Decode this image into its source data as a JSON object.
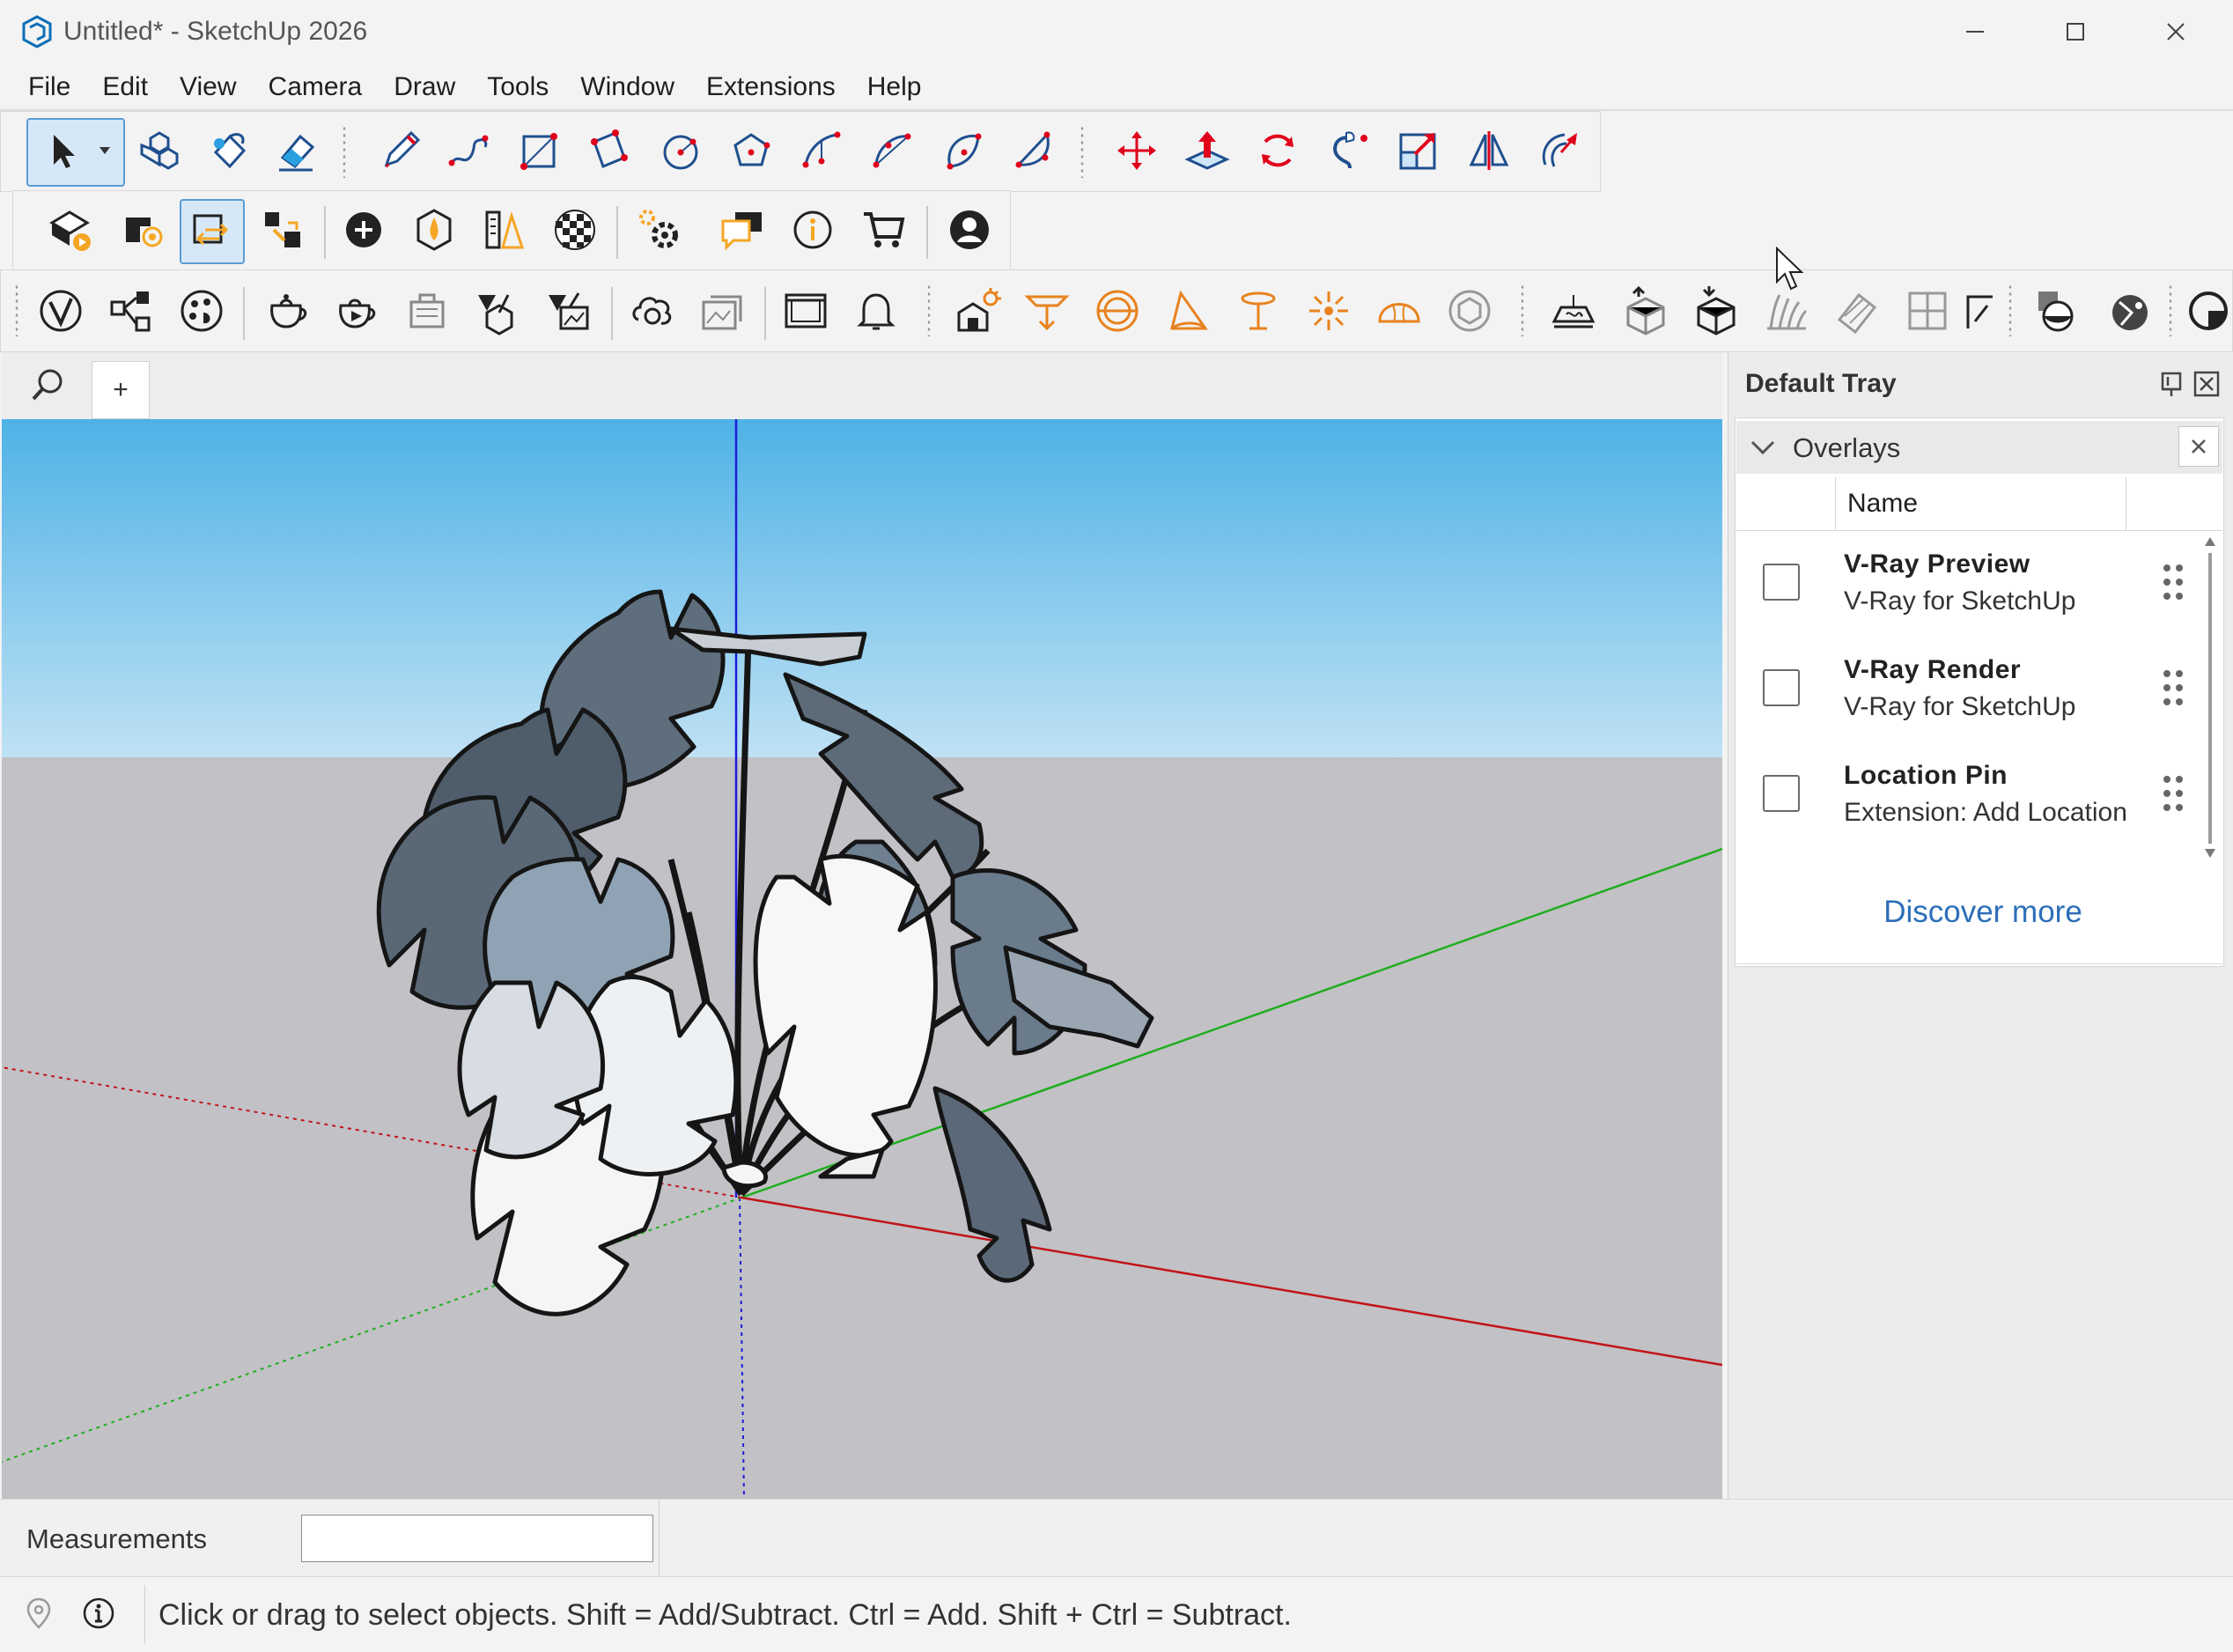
{
  "window": {
    "title": "Untitled* - SketchUp 2026",
    "controls": [
      "minimize",
      "maximize",
      "close"
    ]
  },
  "menu": [
    "File",
    "Edit",
    "View",
    "Camera",
    "Draw",
    "Tools",
    "Window",
    "Extensions",
    "Help"
  ],
  "toolbars": {
    "row1": [
      "select-icon",
      "make-component-icon",
      "paint-bucket-icon",
      "eraser-icon",
      "pencil-icon",
      "freehand-icon",
      "rectangle-icon",
      "rotated-rectangle-icon",
      "circle-icon",
      "polygon-icon",
      "arc-icon",
      "two-point-arc-icon",
      "three-point-arc-icon",
      "pie-icon",
      "move-icon",
      "push-pull-icon",
      "rotate-icon",
      "follow-me-icon",
      "scale-icon",
      "flip-icon",
      "offset-icon"
    ],
    "row2": [
      "warehouse-icon",
      "extension-warehouse-icon",
      "live-component-icon",
      "dynamic-components-icon",
      "add-icon",
      "trimble-connect-icon",
      "style-builder-icon",
      "checker-icon",
      "extension-manager-icon",
      "messages-icon",
      "info-icon",
      "cart-icon",
      "account-icon"
    ],
    "row3": [
      "vray-icon",
      "vray-asset-editor-icon",
      "vray-frame-buffer-icon",
      "teapot-icon",
      "teapot-interactive-icon",
      "teapot-cloud-icon",
      "vray-proxy-icon",
      "vray-mesh-icon",
      "vray-chaos-cloud-icon",
      "vray-batch-icon",
      "vray-viewport-icon",
      "vray-notification-icon",
      "sun-scene-icon",
      "rect-light-icon",
      "sphere-light-icon",
      "spot-light-icon",
      "ies-light-icon",
      "omni-light-icon",
      "dome-light-icon",
      "mesh-light-icon",
      "infinite-plane-icon",
      "export-proxy-icon",
      "import-proxy-icon",
      "fur-icon",
      "scatter-icon",
      "decal-icon",
      "section-icon",
      "material-icon",
      "vray-ball-icon",
      "vray-extra-icon"
    ]
  },
  "scene_tabs": {
    "add": "+"
  },
  "tray": {
    "title": "Default Tray",
    "panel": {
      "title": "Overlays",
      "column": "Name",
      "items": [
        {
          "name": "V-Ray Preview",
          "source": "V-Ray for SketchUp",
          "checked": false
        },
        {
          "name": "V-Ray Render",
          "source": "V-Ray for SketchUp",
          "checked": false
        },
        {
          "name": "Location Pin",
          "source": "Extension: Add Location",
          "checked": false
        }
      ],
      "discover": "Discover more"
    }
  },
  "measurements": {
    "label": "Measurements",
    "value": ""
  },
  "status": {
    "text": "Click or drag to select objects. Shift = Add/Subtract. Ctrl = Add. Shift + Ctrl = Subtract."
  },
  "colors": {
    "accent": "#2c6eb8",
    "sky_top": "#4eb2e6",
    "ground": "#c2c1c5",
    "axis_red": "#c1141a",
    "axis_green": "#1fae1f",
    "axis_blue": "#1d1dd8"
  }
}
